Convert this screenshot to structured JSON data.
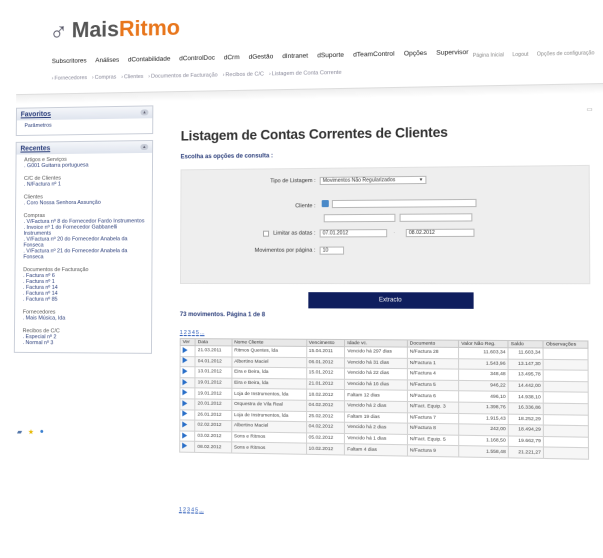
{
  "header": {
    "brand_prefix": "Mais",
    "brand_suffix": "Ritmo",
    "top_links": [
      "Página Inicial",
      "Logout",
      "Opções de configuração"
    ],
    "main_nav": [
      "Subscritores",
      "Análises",
      "dContabilidade",
      "dControlDoc",
      "dCrm",
      "dGestão",
      "dIntranet",
      "dSuporte",
      "dTeamControl",
      "Opções",
      "Supervisor"
    ],
    "sub_nav": [
      "Fornecedores",
      "Compras",
      "Clientes",
      "Documentos de Facturação",
      "Recibos de C/C",
      "Listagem de Conta Corrente"
    ]
  },
  "sidebar": {
    "favoritos": {
      "title": "Favoritos",
      "items": [
        "Parâmetros"
      ]
    },
    "recentes": {
      "title": "Recentes",
      "groups": [
        {
          "title": "Artigos e Serviços",
          "items": [
            ". G001 Guitarra portuguesa"
          ]
        },
        {
          "title": "C/C de Clientes",
          "items": [
            ". N/Factura nº 1"
          ]
        },
        {
          "title": "Clientes",
          "items": [
            ". Coro Nossa Senhora Assunção"
          ]
        },
        {
          "title": "Compras",
          "items": [
            ". V/Factura nº 8 do Fornecedor Fardo Instrumentos",
            ". Invoice nº 1 do Fornecedor Gabbanelli Instruments",
            ". V/Factura nº 20 do Fornecedor Anabela da Fonseca",
            ". V/Factura nº 21 do Fornecedor Anabela da Fonseca"
          ]
        },
        {
          "title": "Documentos de Facturação",
          "items": [
            ". Factura nº 6",
            ". Factura nº 1",
            ". Factura nº 14",
            ". Factura nº 14",
            ". Factura nº 85"
          ]
        },
        {
          "title": "Fornecedores",
          "items": [
            ". Mais Música, lda"
          ]
        },
        {
          "title": "Recibos de C/C",
          "items": [
            ". Especial nº 2",
            ". Normal nº 3"
          ]
        }
      ]
    }
  },
  "main": {
    "title": "Listagem de Contas Correntes de Clientes",
    "subtitle": "Escolha as opções de consulta :",
    "form": {
      "tipo_label": "Tipo de Listagem :",
      "tipo_value": "Movimentos Não Regularizados",
      "cliente_label": "Cliente :",
      "datas_label": "Limitar as datas :",
      "date_from": "07.01.2012",
      "date_to": "08.02.2012",
      "movs_label": "Movimentos por página :",
      "movs_value": "10"
    },
    "extract_label": "Extracto",
    "summary": "73 movimentos. Página 1 de 8",
    "pager": [
      "1",
      "2",
      "3",
      "4",
      "5",
      "..."
    ],
    "table": {
      "headers": [
        "Ver",
        "Data",
        "Nome Cliente",
        "Vencimento",
        "Idade vc.",
        "Documento",
        "Valor Não Reg.",
        "Saldo",
        "Observações"
      ],
      "rows": [
        [
          "21.03.2011",
          "Ritmos Quentes, lda",
          "15.04.2011",
          "Vencido há 297 dias",
          "N/Factura 28",
          "11.603,34",
          "11.603,34",
          ""
        ],
        [
          "04.01.2012",
          "Albertino Maciel",
          "06.01.2012",
          "Vencido há 31 dias",
          "N/Factura 1",
          "1.543,96",
          "13.147,30",
          ""
        ],
        [
          "13.01.2012",
          "Eira e Beira, lda",
          "15.01.2012",
          "Vencido há 22 dias",
          "N/Factura 4",
          "348,48",
          "13.495,78",
          ""
        ],
        [
          "19.01.2012",
          "Eira e Beira, lda",
          "21.01.2012",
          "Vencido há 16 dias",
          "N/Factura 5",
          "946,22",
          "14.442,00",
          ""
        ],
        [
          "19.01.2012",
          "Loja de Instrumentos, lda",
          "18.02.2012",
          "Faltam 12 dias",
          "N/Factura 6",
          "496,10",
          "14.938,10",
          ""
        ],
        [
          "20.01.2012",
          "Orquestra de Vila Real",
          "04.02.2012",
          "Vencido há 2 dias",
          "N/Fact. Equip. 3",
          "1.398,76",
          "16.336,86",
          ""
        ],
        [
          "26.01.2012",
          "Loja de Instrumentos, lda",
          "25.02.2012",
          "Faltam 19 dias",
          "N/Factura 7",
          "1.915,43",
          "18.252,29",
          ""
        ],
        [
          "02.02.2012",
          "Albertino Maciel",
          "04.02.2012",
          "Vencido há 2 dias",
          "N/Factura 8",
          "242,00",
          "18.494,29",
          ""
        ],
        [
          "03.02.2012",
          "Sons e Ritmos",
          "05.02.2012",
          "Vencido há 1 dias",
          "N/Fact. Equip. 5",
          "1.168,50",
          "19.662,79",
          ""
        ],
        [
          "08.02.2012",
          "Sons e Ritmos",
          "10.02.2012",
          "Faltam 4 dias",
          "N/Factura 9",
          "1.558,48",
          "21.221,27",
          ""
        ]
      ]
    }
  }
}
